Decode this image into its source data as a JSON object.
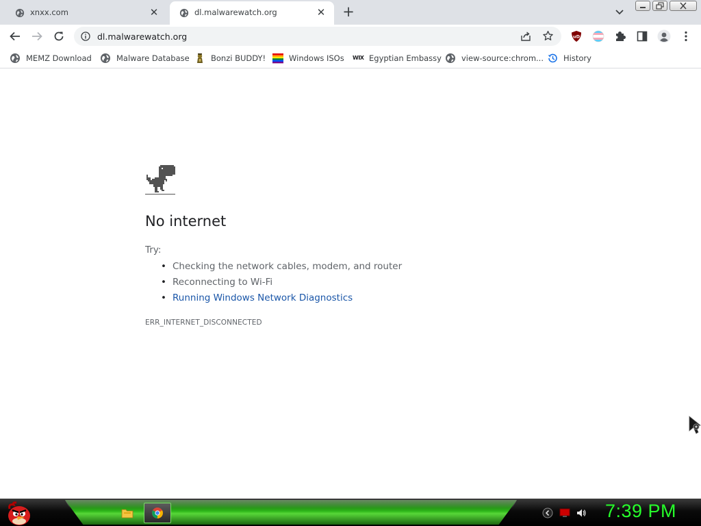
{
  "tabs": [
    {
      "title": "xnxx.com",
      "active": false
    },
    {
      "title": "dl.malwarewatch.org",
      "active": true
    }
  ],
  "toolbar": {
    "url": "dl.malwarewatch.org"
  },
  "bookmarks": [
    {
      "label": "MEMZ Download",
      "icon": "globe-icon"
    },
    {
      "label": "Malware Database",
      "icon": "globe-icon"
    },
    {
      "label": "Bonzi BUDDY!",
      "icon": "bonzi-icon"
    },
    {
      "label": "Windows ISOs",
      "icon": "rainbow-flag-icon"
    },
    {
      "label": "Egyptian Embassy",
      "icon": "wix-icon"
    },
    {
      "label": "view-source:chrom...",
      "icon": "globe-icon"
    },
    {
      "label": "History",
      "icon": "history-icon"
    }
  ],
  "wix_label": "WIX",
  "error_page": {
    "heading": "No internet",
    "try_label": "Try:",
    "suggestions": [
      "Checking the network cables, modem, and router",
      "Reconnecting to Wi-Fi",
      "Running Windows Network Diagnostics"
    ],
    "error_code": "ERR_INTERNET_DISCONNECTED"
  },
  "extensions": {
    "ublock_label": "uD"
  },
  "taskbar": {
    "clock": "7:39 PM"
  },
  "colors": {
    "link": "#1a56a8",
    "clock": "#26ff2a",
    "taskbar_glow": "#2fbf1a"
  }
}
